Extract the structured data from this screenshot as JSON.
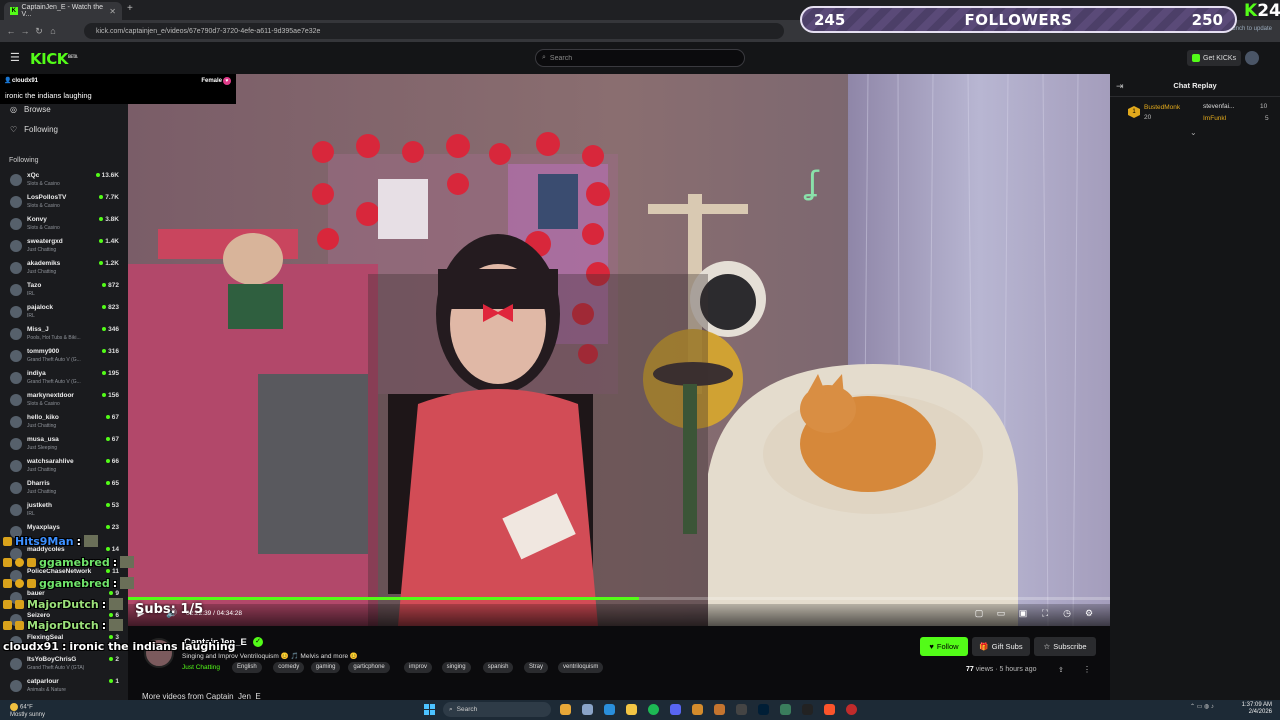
{
  "browser": {
    "tab_title": "CaptainJen_E - Watch the V...",
    "url": "kick.com/captainjen_e/videos/67e790d7-3720-4efe-a611-9d395ae7e32e",
    "relaunch_text": "Relaunch to update"
  },
  "header": {
    "logo_text": "KICK",
    "logo_badge": "BETA",
    "search_placeholder": "Search",
    "get_kicks_label": "Get KICKs"
  },
  "goal_overlay": {
    "current": "245",
    "label": "FOLLOWERS",
    "target": "250",
    "progress_fraction": 0.98
  },
  "kick24": {
    "k": "K",
    "num": "24"
  },
  "viewer_card": {
    "username": "cloudx91",
    "gender": "Female",
    "message": "ironic the indians laughing"
  },
  "sidebar": {
    "nav": [
      {
        "label": "Browse",
        "icon": "compass-icon"
      },
      {
        "label": "Following",
        "icon": "heart-icon"
      }
    ],
    "following_header": "Following",
    "following": [
      {
        "name": "xQc",
        "category": "Slots & Casino",
        "viewers": "13.6K"
      },
      {
        "name": "LosPollosTV",
        "category": "Slots & Casino",
        "viewers": "7.7K"
      },
      {
        "name": "Konvy",
        "category": "Slots & Casino",
        "viewers": "3.8K"
      },
      {
        "name": "sweatergxd",
        "category": "Just Chatting",
        "viewers": "1.4K"
      },
      {
        "name": "akademiks",
        "category": "Just Chatting",
        "viewers": "1.2K"
      },
      {
        "name": "Tazo",
        "category": "IRL",
        "viewers": "872"
      },
      {
        "name": "pajalock",
        "category": "IRL",
        "viewers": "823"
      },
      {
        "name": "Miss_J",
        "category": "Pools, Hot Tubs & Biki...",
        "viewers": "346"
      },
      {
        "name": "tommy900",
        "category": "Grand Theft Auto V (G...",
        "viewers": "316"
      },
      {
        "name": "indiya",
        "category": "Grand Theft Auto V (G...",
        "viewers": "195"
      },
      {
        "name": "markynextdoor",
        "category": "Slots & Casino",
        "viewers": "156"
      },
      {
        "name": "hello_kiko",
        "category": "Just Chatting",
        "viewers": "67"
      },
      {
        "name": "musa_usa",
        "category": "Just Sleeping",
        "viewers": "67"
      },
      {
        "name": "watchsarahlive",
        "category": "Just Chatting",
        "viewers": "66"
      },
      {
        "name": "Dharris",
        "category": "Just Chatting",
        "viewers": "65"
      },
      {
        "name": "justketh",
        "category": "IRL",
        "viewers": "53"
      },
      {
        "name": "Myaxplays",
        "category": "",
        "viewers": "23"
      },
      {
        "name": "maddycoles",
        "category": "",
        "viewers": "14"
      },
      {
        "name": "PoliceChaseNetwork",
        "category": "",
        "viewers": "11"
      },
      {
        "name": "bauer",
        "category": "",
        "viewers": "9"
      },
      {
        "name": "Seizero",
        "category": "",
        "viewers": "6"
      },
      {
        "name": "FlexingSeal",
        "category": "",
        "viewers": "3"
      },
      {
        "name": "ItsYoBoyChrisG",
        "category": "Grand Theft Auto V (GTA)",
        "viewers": "2"
      },
      {
        "name": "catparlour",
        "category": "Animals & Nature",
        "viewers": "1"
      }
    ]
  },
  "stream_chat_overlay": [
    {
      "user": "Hits9Man",
      "color": "#3c8fff",
      "text": "",
      "badges": [
        "sub"
      ]
    },
    {
      "user": "ggamebred",
      "color": "#6fe46a",
      "text": "",
      "badges": [
        "sub",
        "gold",
        "sub"
      ]
    },
    {
      "user": "ggamebred",
      "color": "#6fe46a",
      "text": "",
      "badges": [
        "sub",
        "gold",
        "sub"
      ]
    },
    {
      "user": "MajorDutch",
      "color": "#9be07a",
      "text": "",
      "badges": [
        "sub",
        "sub"
      ]
    },
    {
      "user": "MajorDutch",
      "color": "#9be07a",
      "text": "",
      "badges": [
        "sub",
        "sub"
      ]
    },
    {
      "user": "cloudx91",
      "color": "#ffffff",
      "text": "ironic the indians laughing",
      "badges": []
    }
  ],
  "subs_counter": "Subs: 1/5",
  "player": {
    "time": "02:22:39 / 04:34:28",
    "progress_fraction": 0.52
  },
  "stream_info": {
    "channel": "CaptainJen_E",
    "title": "Singing and Improv Ventriloquism 😊 🎵 Melvis and more 😊",
    "category": "Just Chatting",
    "tags": [
      "English",
      "comedy",
      "gaming",
      "garticphone",
      "improv",
      "singing",
      "spanish",
      "Stray",
      "ventriloquism"
    ],
    "follow_label": "Follow",
    "giftsubs_label": "Gift Subs",
    "subscribe_label": "Subscribe",
    "views": "77",
    "views_suffix": "views",
    "ago": "5 hours ago",
    "more_videos": "More videos from Captain_Jen_E"
  },
  "chat": {
    "title": "Chat Replay",
    "leaderboard": [
      {
        "name": "BustedMonk",
        "amount": "20",
        "color": "#e2a91c"
      },
      {
        "name": "stevenfai...",
        "amount": "10",
        "color": "#dddddd"
      },
      {
        "name": "ImFunkI",
        "amount": "5",
        "color": "#e2a91c"
      }
    ]
  },
  "taskbar": {
    "weather_temp": "64°F",
    "weather_desc": "Mostly sunny",
    "search_label": "Search",
    "time": "1:37:09 AM",
    "date": "2/4/2026"
  }
}
